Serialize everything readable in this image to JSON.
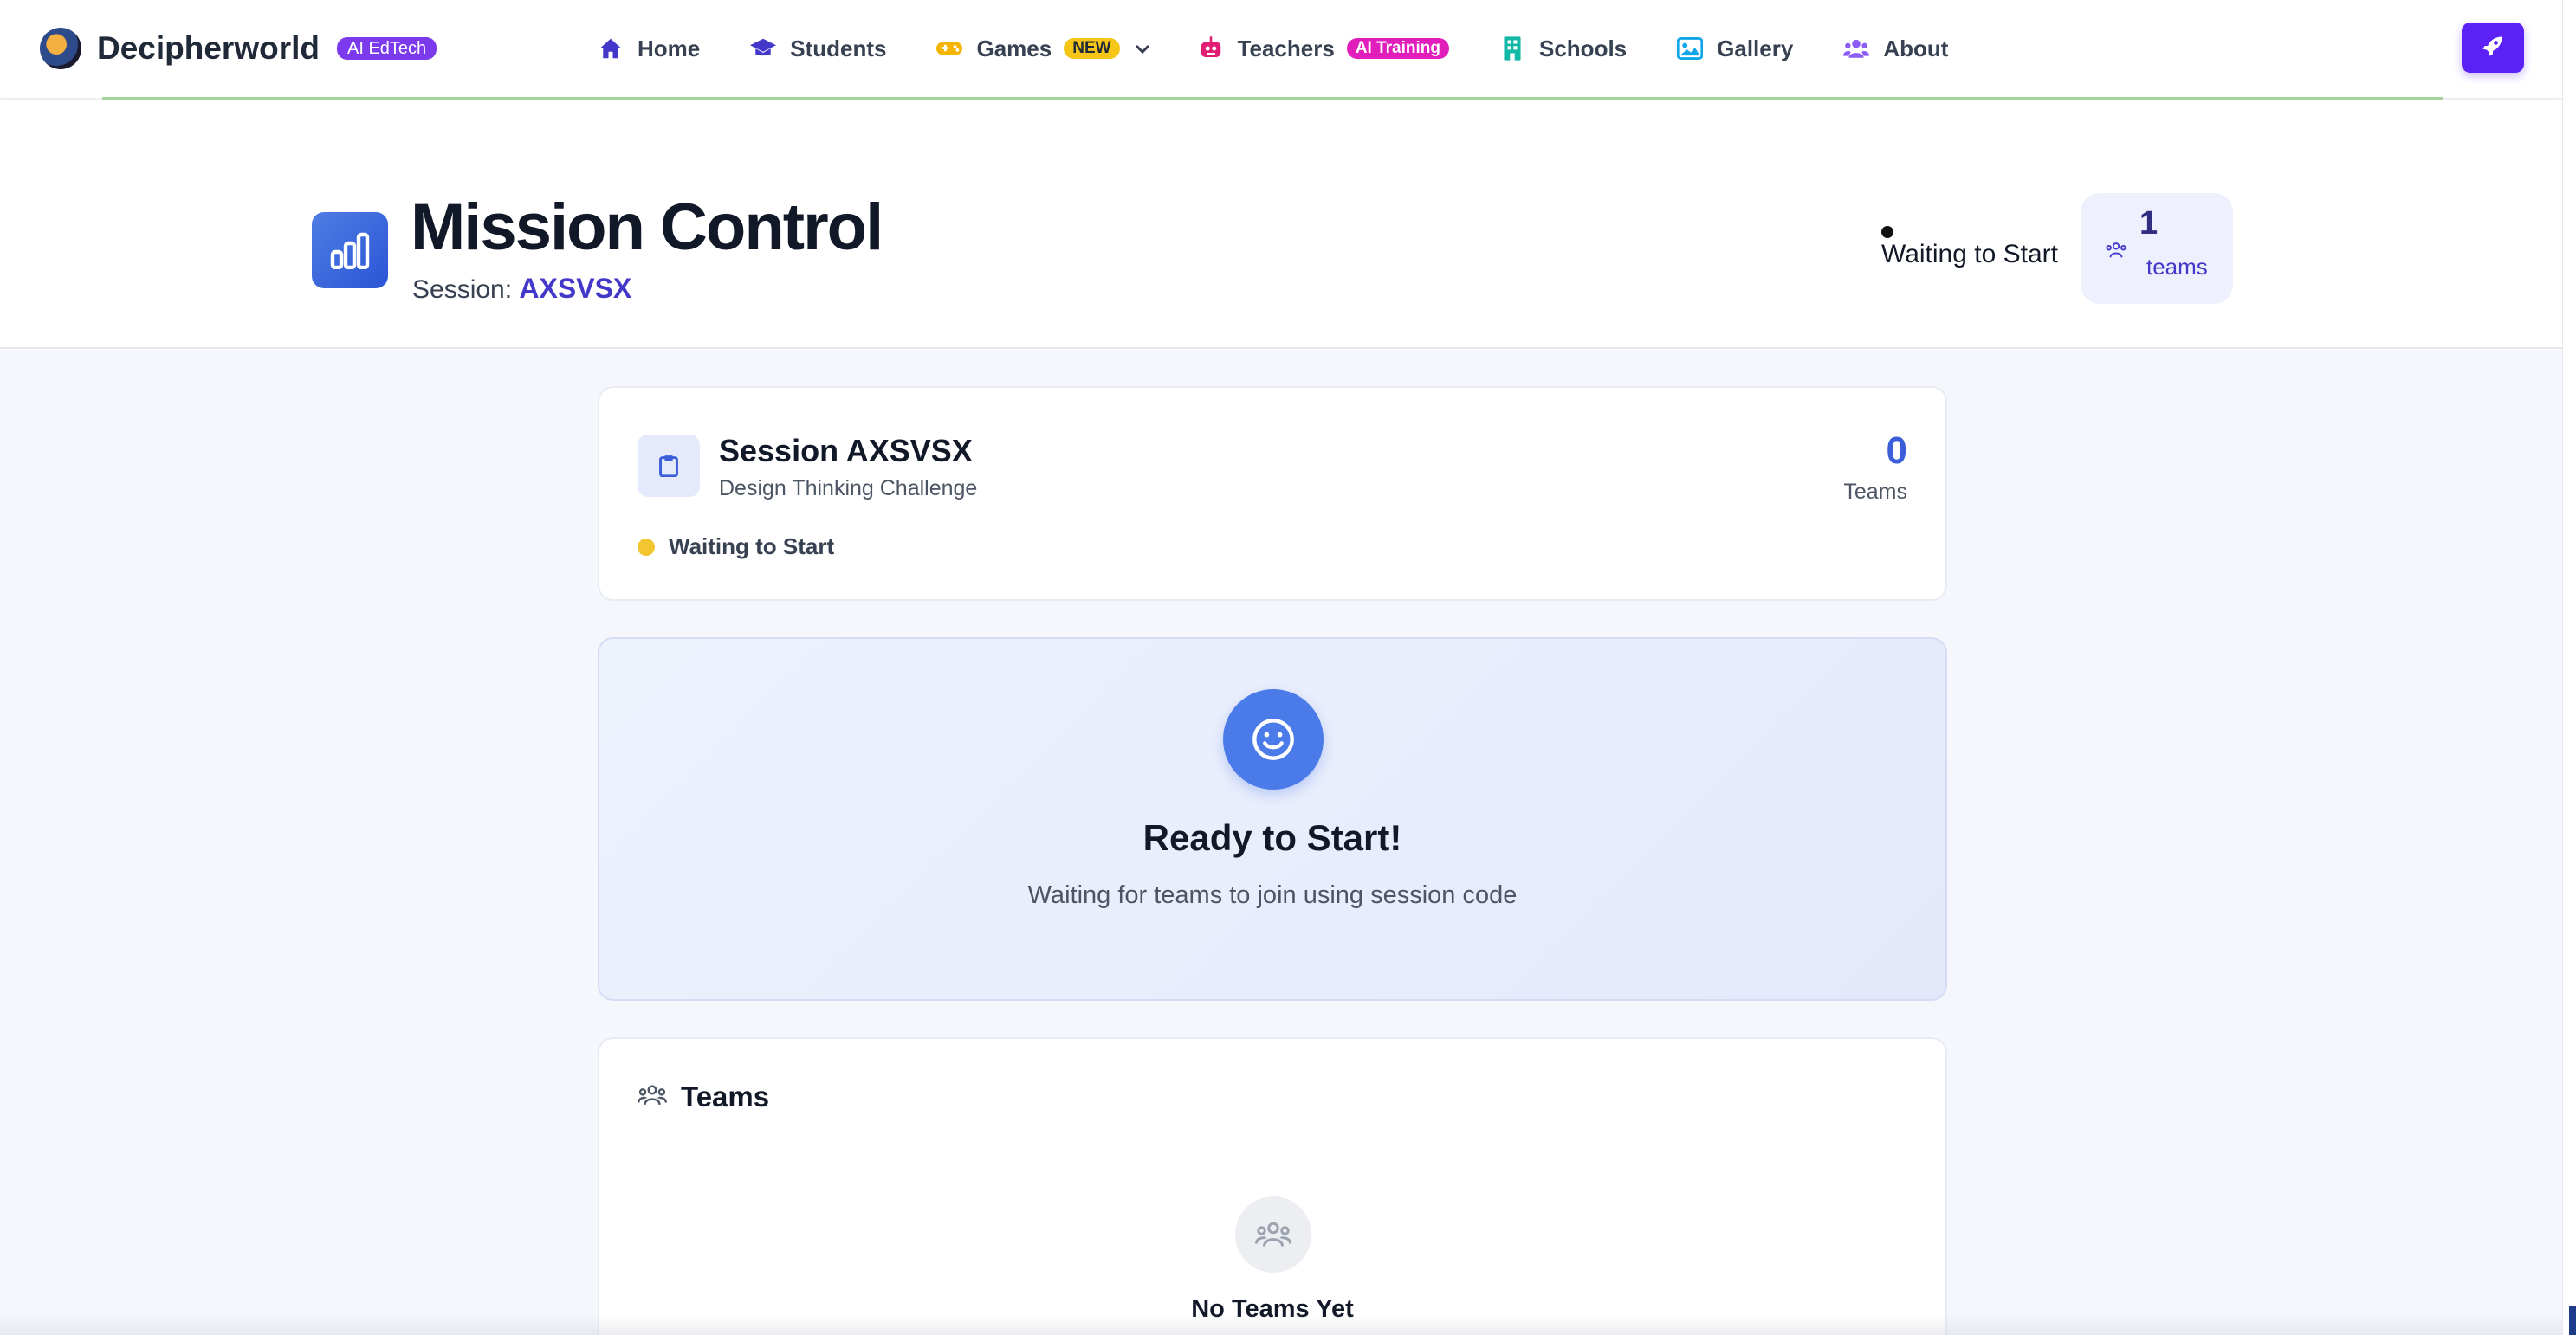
{
  "brand": {
    "name": "Decipherworld",
    "badge": "AI EdTech"
  },
  "nav": {
    "items": [
      {
        "label": "Home",
        "icon": "home-icon",
        "color": "#4338ca"
      },
      {
        "label": "Students",
        "icon": "graduation-cap-icon",
        "color": "#4338ca"
      },
      {
        "label": "Games",
        "icon": "gamepad-icon",
        "color": "#f5b400",
        "badge": "NEW"
      },
      {
        "label": "Teachers",
        "icon": "robot-icon",
        "color": "#e11d74",
        "badge": "AI Training"
      },
      {
        "label": "Schools",
        "icon": "building-icon",
        "color": "#14b8a6"
      },
      {
        "label": "Gallery",
        "icon": "image-icon",
        "color": "#0ea5e9"
      },
      {
        "label": "About",
        "icon": "users-icon",
        "color": "#8b5cf6"
      }
    ],
    "action_icon": "rocket-icon"
  },
  "header": {
    "title": "Mission Control",
    "session_label": "Session:",
    "session_code": "AXSVSX",
    "status": "Waiting to Start",
    "teams_count": "1",
    "teams_label": "teams"
  },
  "session_card": {
    "title": "Session AXSVSX",
    "subtitle": "Design Thinking Challenge",
    "team_count": "0",
    "team_count_label": "Teams",
    "status": "Waiting to Start"
  },
  "ready_card": {
    "title": "Ready to Start!",
    "subtitle": "Waiting for teams to join using session code"
  },
  "teams_card": {
    "title": "Teams",
    "empty_title": "No Teams Yet"
  },
  "colors": {
    "primary": "#5b21f5",
    "accent_blue": "#3b5fd9",
    "status_yellow": "#f3c531"
  }
}
